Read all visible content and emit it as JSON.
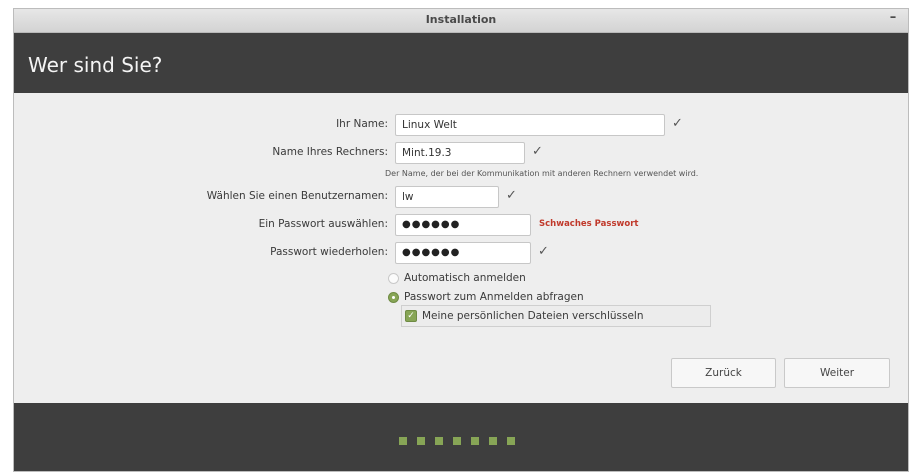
{
  "window": {
    "title": "Installation",
    "minimize_label": "–"
  },
  "header": {
    "heading": "Wer sind Sie?"
  },
  "form": {
    "name": {
      "label": "Ihr Name:",
      "value": "Linux Welt"
    },
    "computer": {
      "label": "Name Ihres Rechners:",
      "value": "Mint.19.3",
      "hint": "Der Name, der bei der Kommunikation mit anderen Rechnern verwendet wird."
    },
    "username": {
      "label": "Wählen Sie einen Benutzernamen:",
      "value": "lw"
    },
    "password": {
      "label": "Ein Passwort auswählen:",
      "value": "●●●●●●",
      "strength": "Schwaches Passwort"
    },
    "password_repeat": {
      "label": "Passwort wiederholen:",
      "value": "●●●●●●"
    },
    "check_mark": "✓",
    "auto_login": {
      "label": "Automatisch anmelden",
      "selected": false
    },
    "require_password": {
      "label": "Passwort zum Anmelden abfragen",
      "selected": true
    },
    "encrypt_home": {
      "label": "Meine persönlichen Dateien verschlüsseln",
      "checked": true
    }
  },
  "buttons": {
    "back": "Zurück",
    "next": "Weiter"
  },
  "progress": {
    "steps_total": 7
  },
  "colors": {
    "accent": "#87a556",
    "header_bg": "#3e3e3e",
    "warning": "#c0392b"
  }
}
